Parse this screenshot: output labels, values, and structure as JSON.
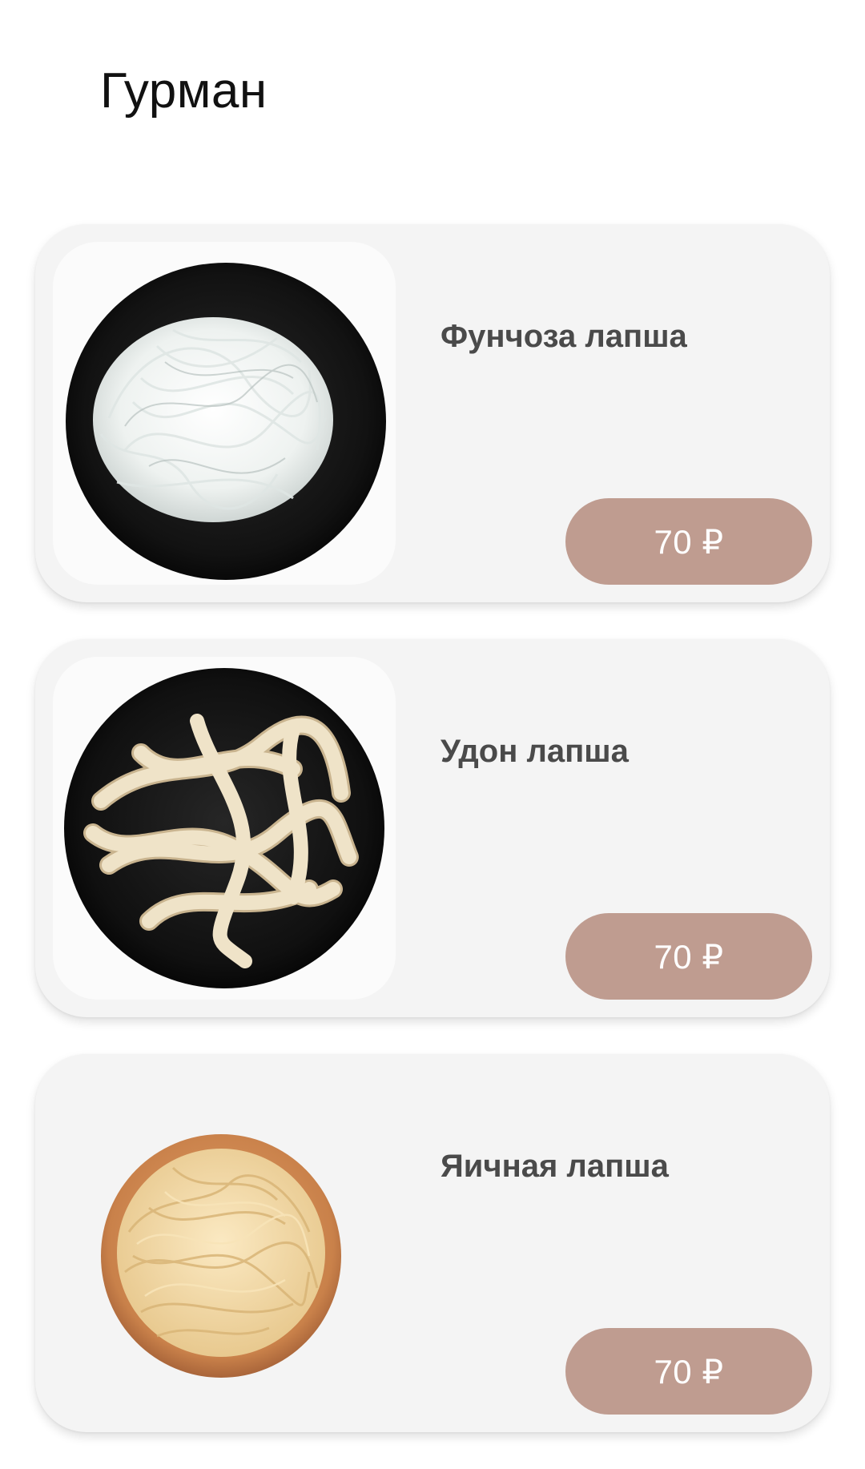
{
  "header": {
    "title": "Гурман"
  },
  "products": [
    {
      "name": "Фунчоза лапша",
      "price": "70 ₽",
      "image_icon": "funchoza-noodles-bowl-image"
    },
    {
      "name": "Удон лапша",
      "price": "70 ₽",
      "image_icon": "udon-noodles-bowl-image"
    },
    {
      "name": "Яичная лапша",
      "price": "70 ₽",
      "image_icon": "egg-noodles-bowl-image"
    }
  ],
  "colors": {
    "card_background": "#f4f4f4",
    "price_button": "#bf9c90",
    "product_name_text": "#4a4a4a"
  }
}
